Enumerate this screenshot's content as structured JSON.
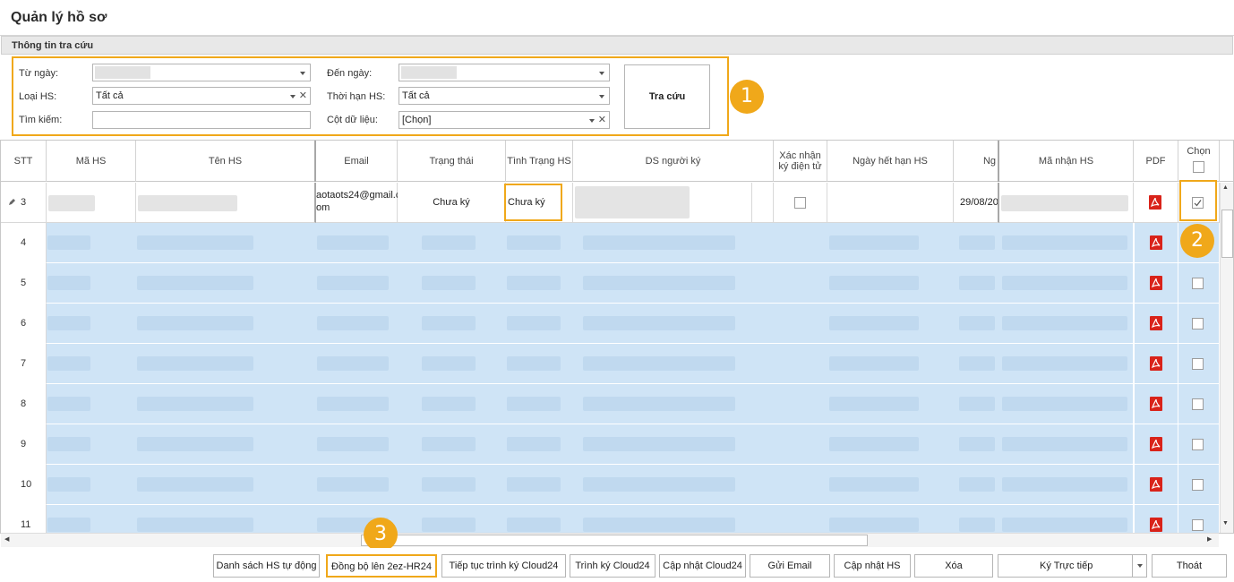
{
  "window": {
    "title": "Quản lý hồ sơ"
  },
  "search": {
    "group_title": "Thông tin tra cứu",
    "from_date_label": "Từ ngày:",
    "to_date_label": "Đến ngày:",
    "type_label": "Loại HS:",
    "type_value": "Tất cả",
    "term_label": "Thời hạn HS:",
    "term_value": "Tất cả",
    "keyword_label": "Tìm kiếm:",
    "keyword_value": "",
    "column_label": "Cột dữ liệu:",
    "column_value": "[Chọn]",
    "search_button": "Tra cứu"
  },
  "badges": {
    "one": "1",
    "two": "2",
    "three": "3"
  },
  "grid": {
    "columns": {
      "stt": "STT",
      "code": "Mã HS",
      "name": "Tên HS",
      "email": "Email",
      "status": "Trạng thái",
      "record_status": "Tình Trạng HS",
      "signers": "DS người ký",
      "e_confirm_1": "Xác nhận",
      "e_confirm_2": "ký điện tử",
      "expiry": "Ngày hết hạn HS",
      "date": "Ng",
      "receive_code": "Mã nhận HS",
      "pdf": "PDF",
      "select": "Chọn"
    },
    "first_row": {
      "stt": "3",
      "email_1": "aotaots24@gmail.c",
      "email_2": "om",
      "status": "Chưa ký",
      "record_status": "Chưa ký",
      "date": "29/08/20"
    },
    "rows": [
      "4",
      "5",
      "6",
      "7",
      "8",
      "9",
      "10",
      "11"
    ]
  },
  "actions": {
    "list_auto": "Danh sách HS tự động",
    "sync": "Đồng bộ lên 2ez-HR24",
    "continue_sign": "Tiếp tục trình ký Cloud24",
    "submit_sign": "Trình ký Cloud24",
    "update_cloud": "Cập nhật Cloud24",
    "send_email": "Gửi Email",
    "update_hs": "Cập nhật HS",
    "delete": "Xóa",
    "sign_direct": "Ký Trực tiếp",
    "exit": "Thoát"
  }
}
